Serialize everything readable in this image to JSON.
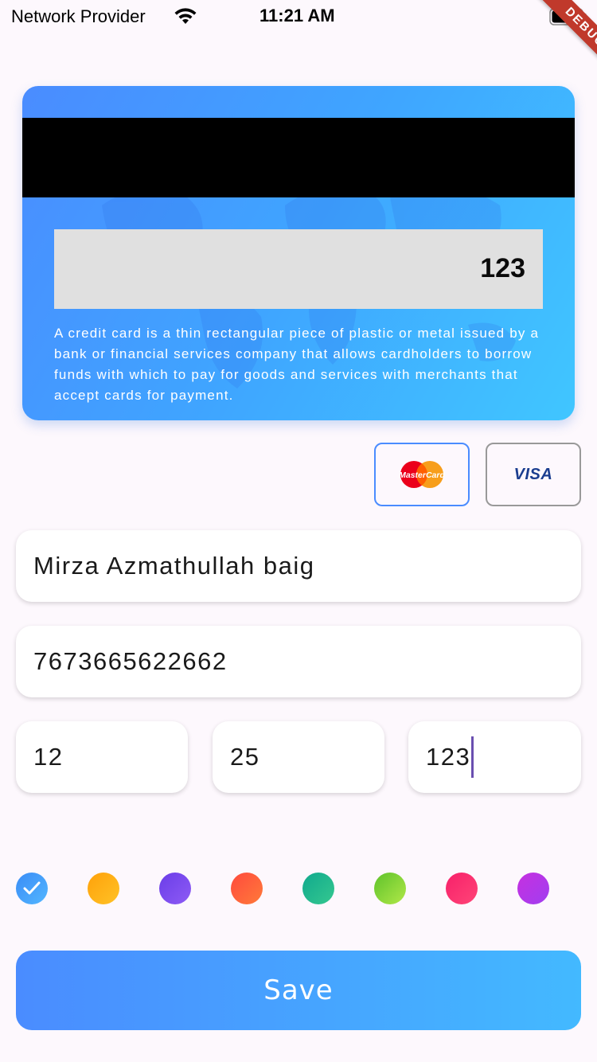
{
  "status_bar": {
    "carrier": "Network Provider",
    "time": "11:21 AM"
  },
  "debug_banner": "DEBUG",
  "card": {
    "cvv": "123",
    "description": "A credit card is a thin rectangular piece of plastic or metal issued by a bank or financial services company that allows cardholders to borrow funds with which to pay for goods and services with merchants that accept cards for payment.",
    "gradient_colors": [
      "#4a8cff",
      "#40c6ff"
    ]
  },
  "card_types": [
    {
      "logo": "MasterCard",
      "selected": true
    },
    {
      "logo": "VISA",
      "selected": false
    }
  ],
  "form": {
    "card_holder": "Mirza Azmathullah baig",
    "card_number": "7673665622662",
    "expiry_month": "12",
    "expiry_year": "25",
    "cvv": "123"
  },
  "theme_colors": [
    {
      "from": "#3a8cf6",
      "to": "#53b6ff",
      "selected": true
    },
    {
      "from": "#ffa10a",
      "to": "#ffc226",
      "selected": false
    },
    {
      "from": "#6a3de8",
      "to": "#8e5bf5",
      "selected": false
    },
    {
      "from": "#ff4a3d",
      "to": "#ff7a3a",
      "selected": false
    },
    {
      "from": "#10a98e",
      "to": "#35c88f",
      "selected": false
    },
    {
      "from": "#5ec22b",
      "to": "#b1e848",
      "selected": false
    },
    {
      "from": "#f7206a",
      "to": "#ff4577",
      "selected": false
    },
    {
      "from": "#c630e0",
      "to": "#a13ef0",
      "selected": false
    }
  ],
  "save_label": "Save"
}
